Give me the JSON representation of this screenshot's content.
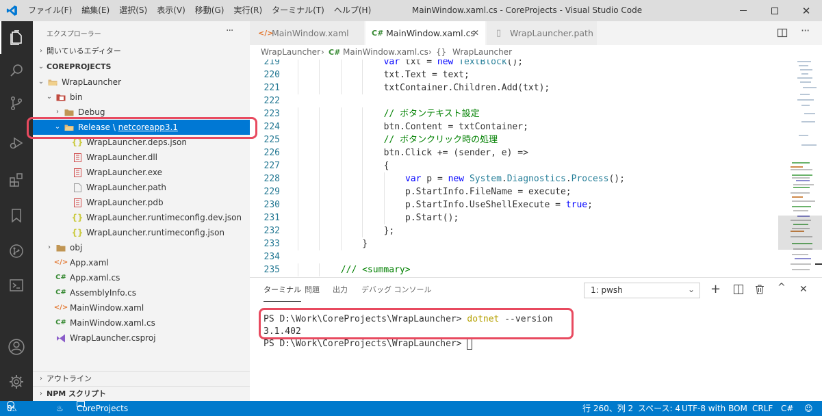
{
  "window": {
    "title": "MainWindow.xaml.cs - CoreProjects - Visual Studio Code"
  },
  "menu": [
    "ファイル(F)",
    "編集(E)",
    "選択(S)",
    "表示(V)",
    "移動(G)",
    "実行(R)",
    "ターミナル(T)",
    "ヘルプ(H)"
  ],
  "colors": {
    "accent": "#007acc",
    "highlight": "#e84a5f",
    "activity_bg": "#2c2c2c",
    "selection": "#0078d4"
  },
  "sidebar": {
    "title": "エクスプローラー",
    "more": "···",
    "open_editors": "開いているエディター",
    "workspace": "COREPROJECTS",
    "tree": [
      {
        "label": "WrapLauncher",
        "icon": "folder-open-icon",
        "chev": "⌄"
      },
      {
        "label": "bin",
        "icon": "folder-bin-icon",
        "chev": "⌄"
      },
      {
        "label": "Debug",
        "icon": "folder-icon",
        "chev": "›"
      },
      {
        "label": "Release",
        "sep": " \\ ",
        "label2": "netcoreapp3.1",
        "icon": "folder-open-icon",
        "chev": "⌄"
      },
      {
        "label": "WrapLauncher.deps.json",
        "icon": "json-icon"
      },
      {
        "label": "WrapLauncher.dll",
        "icon": "binary-icon"
      },
      {
        "label": "WrapLauncher.exe",
        "icon": "binary-icon"
      },
      {
        "label": "WrapLauncher.path",
        "icon": "file-icon"
      },
      {
        "label": "WrapLauncher.pdb",
        "icon": "binary-icon"
      },
      {
        "label": "WrapLauncher.runtimeconfig.dev.json",
        "icon": "json-icon"
      },
      {
        "label": "WrapLauncher.runtimeconfig.json",
        "icon": "json-icon"
      },
      {
        "label": "obj",
        "icon": "folder-icon",
        "chev": "›"
      },
      {
        "label": "App.xaml",
        "icon": "xaml-icon"
      },
      {
        "label": "App.xaml.cs",
        "icon": "csharp-icon"
      },
      {
        "label": "AssemblyInfo.cs",
        "icon": "csharp-icon"
      },
      {
        "label": "MainWindow.xaml",
        "icon": "xaml-icon"
      },
      {
        "label": "MainWindow.xaml.cs",
        "icon": "csharp-icon"
      },
      {
        "label": "WrapLauncher.csproj",
        "icon": "csproj-icon"
      }
    ],
    "outline": "アウトライン",
    "npm": "NPM スクリプト"
  },
  "tabs": [
    {
      "label": "MainWindow.xaml",
      "icon": "</>"
    },
    {
      "label": "MainWindow.xaml.cs",
      "icon": "C#",
      "close": "✕"
    },
    {
      "label": "WrapLauncher.path",
      "icon": "▯"
    }
  ],
  "breadcrumb": {
    "folder": "WrapLauncher",
    "sep": "›",
    "file_icon": "C#",
    "file": "MainWindow.xaml.cs",
    "symbol_icon": "{}",
    "symbol": "WrapLauncher"
  },
  "code": [
    {
      "n": "219",
      "t": "var txt = new TextBlock();"
    },
    {
      "n": "220",
      "t": "txt.Text = text;"
    },
    {
      "n": "221",
      "t": "txtContainer.Children.Add(txt);"
    },
    {
      "n": "222",
      "t": ""
    },
    {
      "n": "223",
      "t": "// ボタンテキスト設定"
    },
    {
      "n": "224",
      "t": "btn.Content = txtContainer;"
    },
    {
      "n": "225",
      "t": "// ボタンクリック時の処理"
    },
    {
      "n": "226",
      "t": "btn.Click += (sender, e) =>"
    },
    {
      "n": "227",
      "t": "{"
    },
    {
      "n": "228",
      "t": "var p = new System.Diagnostics.Process();"
    },
    {
      "n": "229",
      "t": "p.StartInfo.FileName = execute;"
    },
    {
      "n": "230",
      "t": "p.StartInfo.UseShellExecute = true;"
    },
    {
      "n": "231",
      "t": "p.Start();"
    },
    {
      "n": "232",
      "t": "};"
    },
    {
      "n": "233",
      "t": "}"
    },
    {
      "n": "234",
      "t": ""
    },
    {
      "n": "235",
      "t": "/// <summary>"
    }
  ],
  "panel": {
    "tabs": [
      "ターミナル",
      "問題",
      "出力",
      "デバッグ コンソール"
    ],
    "terminal_select": "1: pwsh",
    "lines": [
      {
        "prompt": "PS D:\\Work\\CoreProjects\\WrapLauncher> ",
        "cmd": "dotnet",
        "args": " --version"
      },
      {
        "prompt": "3.1.402",
        "cmd": "",
        "args": ""
      },
      {
        "prompt": "PS D:\\Work\\CoreProjects\\WrapLauncher> ",
        "cmd": "",
        "args": ""
      }
    ]
  },
  "status": {
    "errors": "0",
    "warnings": "0",
    "folder": "CoreProjects",
    "position": "行 260、列 2",
    "spaces": "スペース: 4",
    "encoding": "UTF-8 with BOM",
    "eol": "CRLF",
    "lang": "C#"
  }
}
